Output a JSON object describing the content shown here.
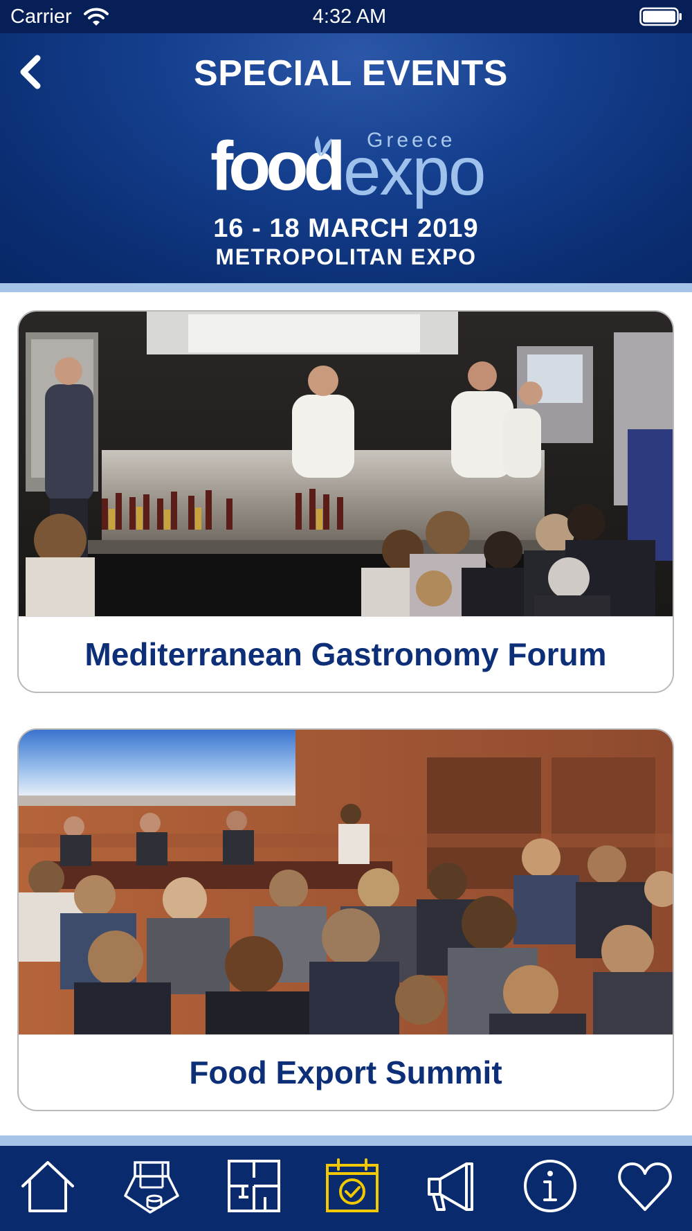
{
  "status_bar": {
    "carrier": "Carrier",
    "time": "4:32 AM"
  },
  "header": {
    "title": "SPECIAL EVENTS",
    "back_icon": "chevron-left-icon",
    "logo": {
      "word_food": "food",
      "word_expo": "expo",
      "country": "Greece"
    },
    "dates": "16 - 18 MARCH 2019",
    "venue": "METROPOLITAN EXPO"
  },
  "events": [
    {
      "title": "Mediterranean Gastronomy Forum",
      "image": "chef-cooking-demonstration-photo"
    },
    {
      "title": "Food Export Summit",
      "image": "conference-audience-photo"
    }
  ],
  "tab_bar": {
    "active_color": "#f2c800",
    "inactive_color": "#ffffff",
    "background": "#0a2a6e",
    "tabs": [
      {
        "icon": "home-icon",
        "active": false
      },
      {
        "icon": "booth-icon",
        "active": false
      },
      {
        "icon": "floor-plan-icon",
        "active": false
      },
      {
        "icon": "calendar-check-icon",
        "active": true
      },
      {
        "icon": "megaphone-icon",
        "active": false
      },
      {
        "icon": "info-icon",
        "active": false
      },
      {
        "icon": "heart-icon",
        "active": false
      }
    ]
  }
}
